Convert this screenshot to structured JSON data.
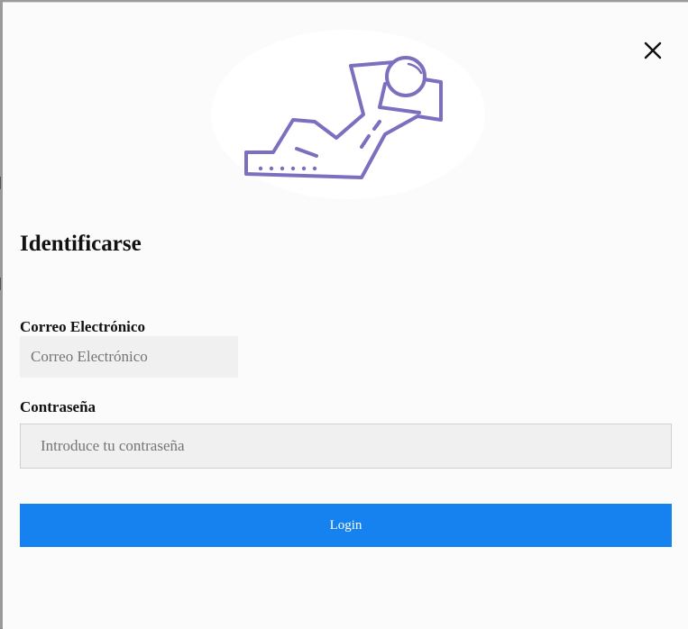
{
  "modal": {
    "title": "Identificarse",
    "close_icon": "close-icon",
    "hero_icon": "relaxing-person-illustration"
  },
  "form": {
    "email": {
      "label": "Correo Electrónico",
      "placeholder": "Correo Electrónico",
      "value": ""
    },
    "password": {
      "label": "Contraseña",
      "placeholder": "Introduce tu contraseña",
      "value": ""
    },
    "submit_label": "Login"
  },
  "colors": {
    "primary_button": "#1582ef",
    "input_background": "#f0f0f0",
    "illustration_stroke": "#7b6fbf"
  }
}
